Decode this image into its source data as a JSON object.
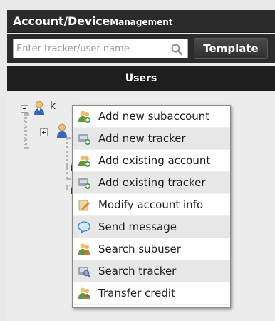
{
  "header": {
    "title_main": "Account/Device",
    "title_sub": "Management"
  },
  "search": {
    "placeholder": "Enter tracker/user name",
    "template_label": "Template"
  },
  "users_panel": {
    "header": "Users",
    "root_label": "k"
  },
  "context_menu": {
    "items": [
      {
        "label": "Add new subaccount",
        "icon": "people-add-icon"
      },
      {
        "label": "Add new tracker",
        "icon": "tracker-add-icon"
      },
      {
        "label": "Add existing account",
        "icon": "people-add-icon"
      },
      {
        "label": "Add existing tracker",
        "icon": "tracker-add-icon"
      },
      {
        "label": "Modify account info",
        "icon": "edit-icon"
      },
      {
        "label": "Send message",
        "icon": "message-icon"
      },
      {
        "label": "Search subuser",
        "icon": "people-search-icon"
      },
      {
        "label": "Search tracker",
        "icon": "tracker-search-icon"
      },
      {
        "label": "Transfer credit",
        "icon": "transfer-icon"
      }
    ]
  },
  "colors": {
    "header_bg": "#2b2b2b",
    "users_header_bg": "#1e1e1e",
    "tree_bg": "#ececec",
    "menu_alt_row": "#e7e7e7"
  }
}
